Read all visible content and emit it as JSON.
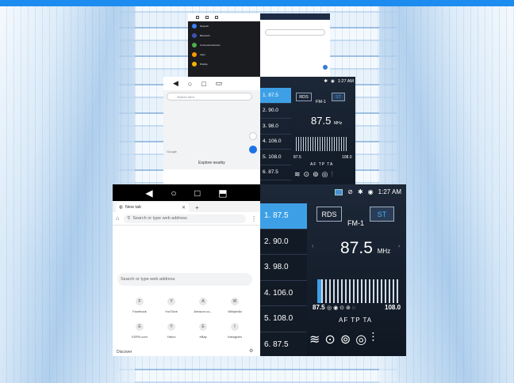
{
  "panel_tl": {
    "items": [
      "Network",
      "Bluetooth",
      "Connected devices",
      "Apps",
      "Display"
    ]
  },
  "maps_small": {
    "search_placeholder": "Search here",
    "google_label": "Google",
    "explore_label": "Explore nearby"
  },
  "radio_small": {
    "time": "1:27 AM",
    "rds_label": "RDS",
    "st_label": "ST",
    "band": "FM-1",
    "frequency": "87.5",
    "unit": "MHz",
    "range_low": "87.5",
    "range_high": "108.0",
    "flags": "AF TP TA",
    "presets": [
      {
        "label": "1.  87.5"
      },
      {
        "label": "2.  90.0"
      },
      {
        "label": "3.  98.0"
      },
      {
        "label": "4.  106.0"
      },
      {
        "label": "5.  108.0"
      },
      {
        "label": "6.  87.5"
      }
    ]
  },
  "browser": {
    "tab_title": "New tab",
    "omnibox_placeholder": "Search or type web address",
    "page_search_placeholder": "Search or type web address",
    "shortcuts": [
      {
        "letter": "F",
        "label": "Facebook"
      },
      {
        "letter": "Y",
        "label": "YouTube"
      },
      {
        "letter": "A",
        "label": "Amazon.co..."
      },
      {
        "letter": "W",
        "label": "Wikipedia"
      },
      {
        "letter": "E",
        "label": "ESPN.com"
      },
      {
        "letter": "Y",
        "label": "Yahoo"
      },
      {
        "letter": "E",
        "label": "eBay"
      },
      {
        "letter": "I",
        "label": "Instagram"
      }
    ],
    "discover_label": "Discover"
  },
  "radio": {
    "time": "1:27 AM",
    "rds_label": "RDS",
    "st_label": "ST",
    "band": "FM-1",
    "frequency": "87.5",
    "unit": "MHz",
    "range_low": "87.5",
    "range_high": "108.0",
    "flags": "AF TP TA",
    "presets": [
      {
        "label": "1.  87.5"
      },
      {
        "label": "2.  90.0"
      },
      {
        "label": "3.  98.0"
      },
      {
        "label": "4.  106.0"
      },
      {
        "label": "5.  108.0"
      },
      {
        "label": "6.  87.5"
      }
    ],
    "selected_preset": 1
  }
}
